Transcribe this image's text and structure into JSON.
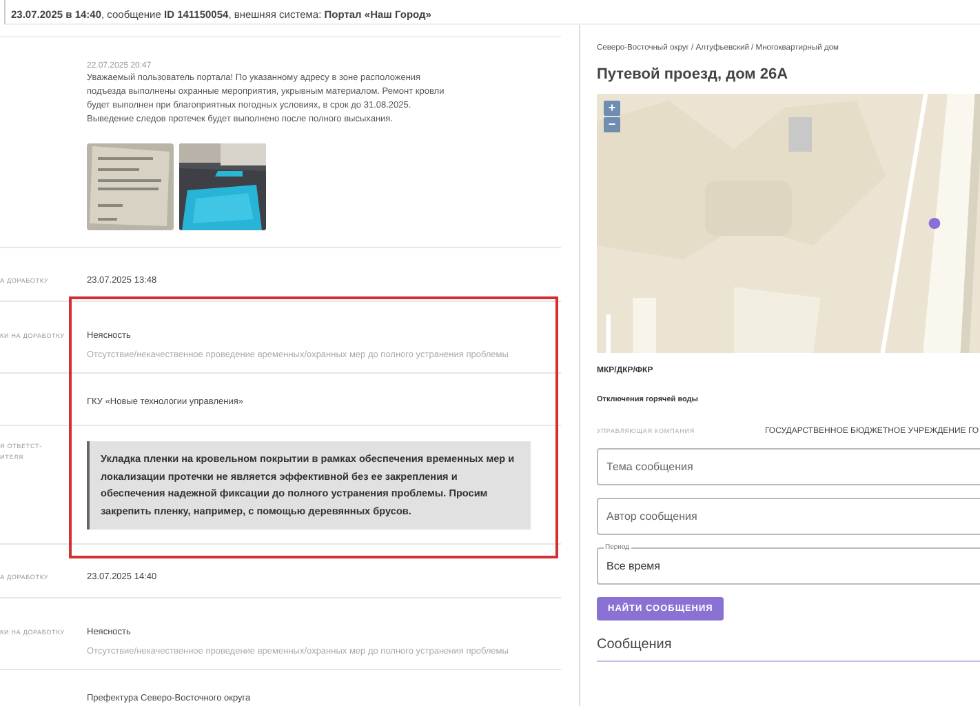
{
  "header": {
    "text": "**23.07.2025 в 14:40**, сообщение **ID 141150054**, внешняя система: **Портал «Наш Город»**"
  },
  "message": {
    "date": "22.07.2025 20:47",
    "text": "Уважаемый пользователь портала! По указанному адресу в зоне расположения подъезда выполнены охранные мероприятия, укрывным материалом. Ремонт кровли будет выполнен при благоприятных погодных условиях, в срок до 31.08.2025. Выведение следов протечек будет выполнено после полного высыхания."
  },
  "rows": [
    {
      "kind": "date",
      "label": "А ДОРАБОТКУ",
      "value": "23.07.2025 13:48"
    },
    {
      "kind": "reason",
      "label": "КИ НА ДОРАБОТКУ",
      "title": "Неясность",
      "description": "Отсутствие/некачественное проведение временных/охранных мер до полного устранения проблемы"
    },
    {
      "kind": "org",
      "value": "ГКУ «Новые технологии управления»"
    },
    {
      "kind": "quote",
      "label": "Я ОТВЕТСТ-\nИТЕЛЯ",
      "value": "Укладка пленки на кровельном покрытии в рамках обеспечения временных мер и локализации протечки не является эффективной без ее закрепления и обеспечения надежной фиксации до полного устранения проблемы. Просим закрепить пленку, например, с помощью деревянных брусов."
    },
    {
      "kind": "date",
      "label": "А ДОРАБОТКУ",
      "value": "23.07.2025 14:40"
    },
    {
      "kind": "reason",
      "label": "КИ НА ДОРАБОТКУ",
      "title": "Неясность",
      "description": "Отсутствие/некачественное проведение временных/охранных мер до полного устранения проблемы"
    },
    {
      "kind": "org",
      "value": "Префектура Северо-Восточного округа"
    }
  ],
  "panel": {
    "breadcrumb": "Северо-Восточный округ / Алтуфьевский / Многоквартирный дом",
    "title": "Путевой проезд, дом 26А",
    "map": {
      "kind": "picture",
      "zoom_in": "+",
      "zoom_out": "−"
    },
    "program": "МКР/ДКР/ФКР",
    "outage": "Отключения горячей воды",
    "company_label": "УПРАВЛЯЮЩАЯ КОМПАНИЯ",
    "company": "ГОСУДАРСТВЕННОЕ БЮДЖЕТНОЕ УЧРЕЖДЕНИЕ ГО",
    "fields": [
      {
        "kind": "text",
        "placeholder": "Тема сообщения"
      },
      {
        "kind": "text",
        "placeholder": "Автор сообщения"
      },
      {
        "kind": "select",
        "label": "Период",
        "value": "Все время"
      }
    ],
    "button": "НАЙТИ СООБЩЕНИЯ",
    "messages_heading": "Сообщения"
  }
}
